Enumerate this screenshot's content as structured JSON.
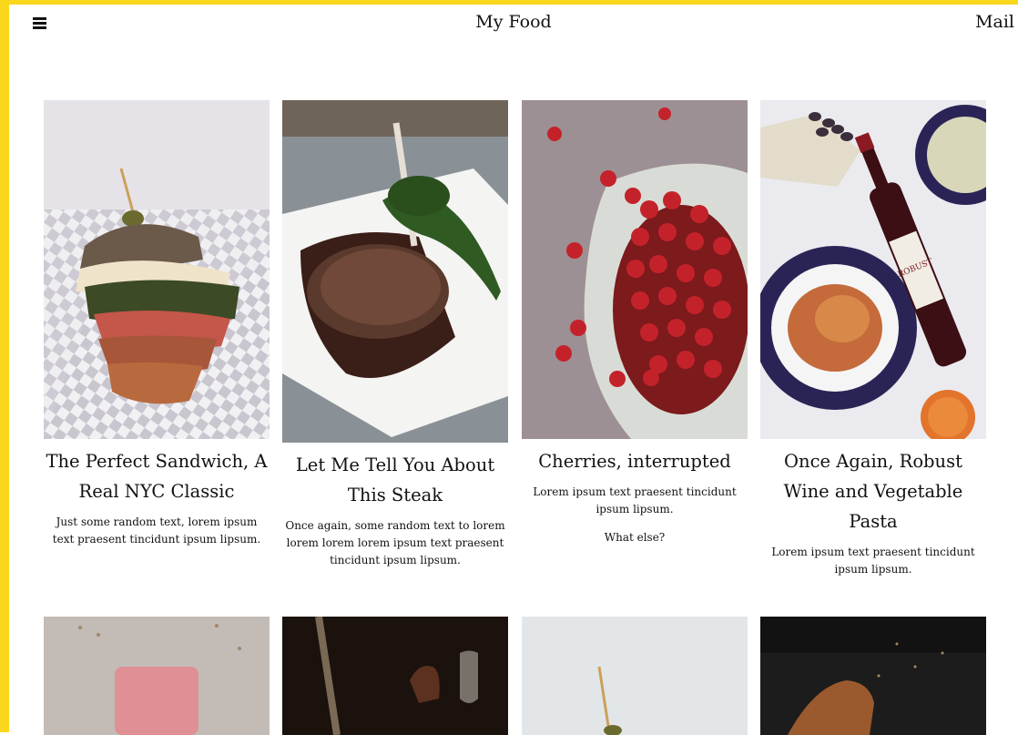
{
  "header": {
    "menu_icon": "hamburger-menu-icon",
    "title": "My Food",
    "mail_label": "Mail"
  },
  "colors": {
    "frame": "#f9d71c",
    "background": "#ffffff",
    "text": "#111111"
  },
  "cards": [
    {
      "title": "The Perfect Sandwich, A Real NYC Classic",
      "text": "Just some random text, lorem ipsum text praesent tincidunt ipsum lipsum.",
      "image": "sandwich-photo"
    },
    {
      "title": "Let Me Tell You About This Steak",
      "text": "Once again, some random text to lorem lorem lorem lorem ipsum text praesent tincidunt ipsum lipsum.",
      "image": "steak-photo"
    },
    {
      "title": "Cherries, interrupted",
      "text": "Lorem ipsum text praesent tincidunt ipsum lipsum.",
      "extra": "What else?",
      "image": "cherries-photo"
    },
    {
      "title": "Once Again, Robust Wine and Vegetable Pasta",
      "text": "Lorem ipsum text praesent tincidunt ipsum lipsum.",
      "image": "wine-pasta-photo",
      "wine_label": "ROBUST"
    }
  ],
  "second_row_images": [
    "cake-photo",
    "wine-glasses-photo",
    "sandwich-photo-2",
    "croissant-photo"
  ]
}
